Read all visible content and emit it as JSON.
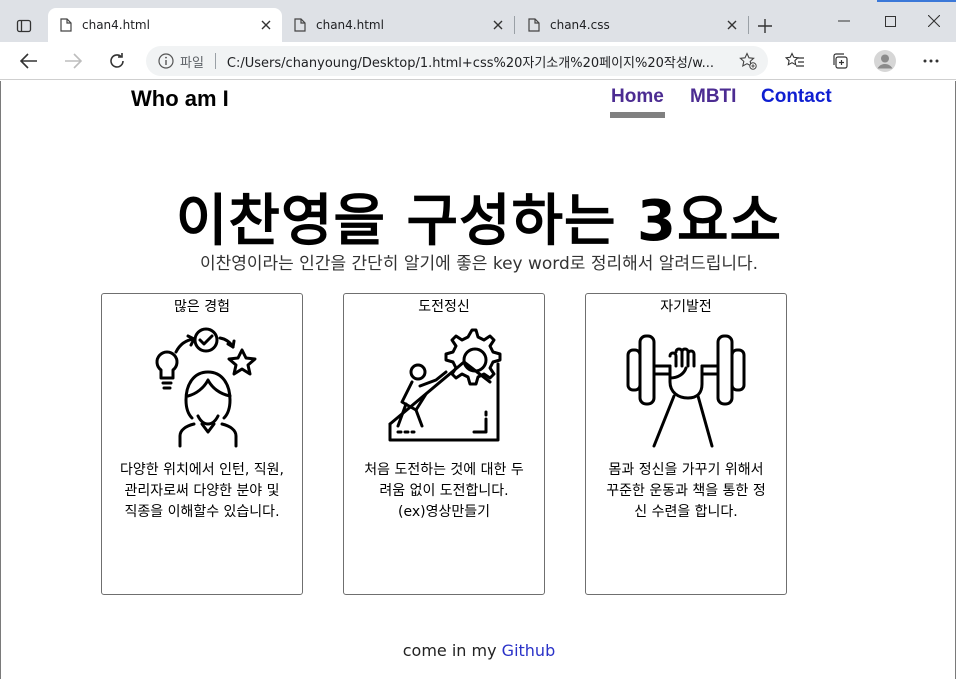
{
  "browser": {
    "tabs": [
      {
        "title": "chan4.html",
        "active": true
      },
      {
        "title": "chan4.html",
        "active": false
      },
      {
        "title": "chan4.css",
        "active": false
      }
    ],
    "address": {
      "protocol_label": "파일",
      "url": "C:/Users/chanyoung/Desktop/1.html+css%20자기소개%20페이지%20작성/w..."
    },
    "icons": [
      "tab-actions-icon",
      "file-icon",
      "close-icon",
      "plus-icon",
      "minimize-icon",
      "maximize-icon",
      "close-window-icon",
      "back-icon",
      "forward-icon",
      "refresh-icon",
      "info-icon",
      "add-favorite-icon",
      "favorites-icon",
      "collections-icon",
      "profile-icon",
      "more-icon"
    ]
  },
  "nav": {
    "brand": "Who am I",
    "links": [
      {
        "label": "Home",
        "color": "#4c2c92"
      },
      {
        "label": "MBTI",
        "color": "#4c2c92"
      },
      {
        "label": "Contact",
        "color": "#0f1fd1"
      }
    ]
  },
  "hero": {
    "title": "이찬영을 구성하는 3요소",
    "subtitle": "이찬영이라는 인간을 간단히 알기에 좋은 key word로 정리해서 알려드립니다."
  },
  "cards": [
    {
      "title": "많은 경험",
      "icon": "experience-person-icon",
      "lines": [
        "다양한 위치에서 인턴, 직원,",
        "관리자로써 다양한 분야 및",
        "직종을 이해할수 있습니다."
      ]
    },
    {
      "title": "도전정신",
      "icon": "climbing-gear-icon",
      "lines": [
        "처음 도전하는 것에 대한 두",
        "려움 없이 도전합니다.",
        "(ex)영상만들기"
      ]
    },
    {
      "title": "자기발전",
      "icon": "dumbbell-hand-icon",
      "lines": [
        "몸과 정신을 가꾸기 위해서",
        "꾸준한 운동과 책을 통한 정",
        "신 수련을 합니다."
      ]
    }
  ],
  "footer": {
    "prefix": "come in my",
    "link": "Github"
  }
}
